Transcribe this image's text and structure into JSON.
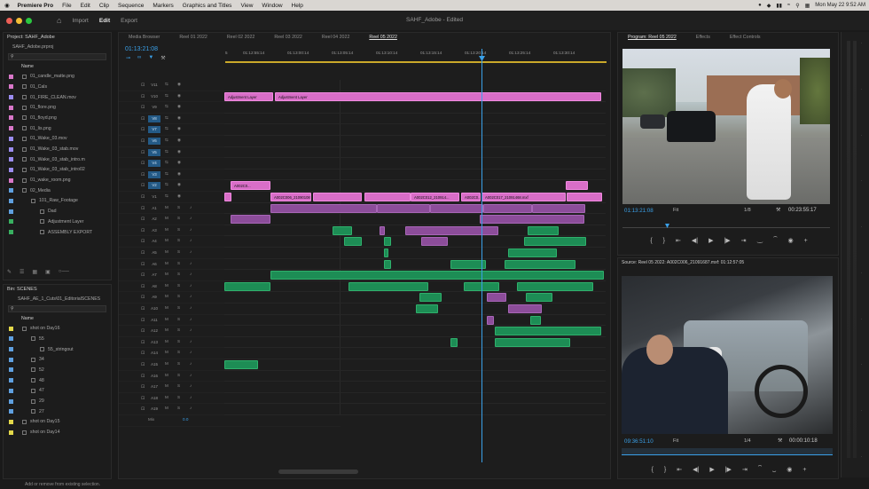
{
  "menubar": {
    "apple": "",
    "app": "Premiere Pro",
    "items": [
      "File",
      "Edit",
      "Clip",
      "Sequence",
      "Markers",
      "Graphics and Titles",
      "View",
      "Window",
      "Help"
    ],
    "clock": "Mon May 22  9:52 AM"
  },
  "topbar": {
    "workspaces": [
      "Import",
      "Edit",
      "Export"
    ],
    "active": "Edit",
    "document_title": "SAHF_Adobe - Edited"
  },
  "project_panel": {
    "title": "Project: SAHF_Adobe",
    "file": "SAHF_Adobe.prproj",
    "column": "Name",
    "items": [
      {
        "label": "01_candle_matte.png",
        "color": "#d977c9"
      },
      {
        "label": "01_Cals",
        "color": "#d977c9"
      },
      {
        "label": "01_FIRE_CLEAN.mov",
        "color": "#9b8cf0"
      },
      {
        "label": "01_flore.png",
        "color": "#d977c9"
      },
      {
        "label": "01_floyd.png",
        "color": "#d977c9"
      },
      {
        "label": "01_lis.png",
        "color": "#d977c9"
      },
      {
        "label": "01_Wake_03.mov",
        "color": "#9b8cf0"
      },
      {
        "label": "01_Wake_03_stab.mov",
        "color": "#9b8cf0"
      },
      {
        "label": "01_Wake_03_stab_intro.m",
        "color": "#9b8cf0"
      },
      {
        "label": "01_Wake_03_stab_intro02",
        "color": "#9b8cf0"
      },
      {
        "label": "01_wake_room.png",
        "color": "#d977c9"
      },
      {
        "label": "02_Media",
        "color": "#5fa0e0"
      },
      {
        "label": "101_Raw_Footage",
        "color": "#5fa0e0"
      },
      {
        "label": "Dad",
        "color": "#5fa0e0"
      },
      {
        "label": "Adjustment Layer",
        "color": "#38b060"
      },
      {
        "label": "ASSEMBLY EXPORT",
        "color": "#38b060"
      }
    ]
  },
  "bin_panel": {
    "title": "Bin: SCENES",
    "path": "SAHF_AE_1_Cuts\\01_EditorialSCENES",
    "column": "Name",
    "items": [
      {
        "label": "shot on Day16",
        "color": "#e3d84a"
      },
      {
        "label": "55",
        "color": "#5fa0e0"
      },
      {
        "label": "55_stringout",
        "color": "#5fa0e0"
      },
      {
        "label": "34",
        "color": "#5fa0e0"
      },
      {
        "label": "52",
        "color": "#5fa0e0"
      },
      {
        "label": "48",
        "color": "#5fa0e0"
      },
      {
        "label": "47",
        "color": "#5fa0e0"
      },
      {
        "label": "29",
        "color": "#5fa0e0"
      },
      {
        "label": "27",
        "color": "#5fa0e0"
      },
      {
        "label": "shot on Day15",
        "color": "#e3d84a"
      },
      {
        "label": "shot on Day14",
        "color": "#e3d84a"
      }
    ]
  },
  "timeline": {
    "tabs": [
      "Media Browser",
      "Reel 01 2022",
      "Reel 02 2022",
      "Reel 03 2022",
      "Reel 04 2022",
      "Reel 05 2022"
    ],
    "active_tab": "Reel 05 2022",
    "timecode": "01:13:21:08",
    "ruler": [
      "5",
      "01:12:55:14",
      "01:13:00:14",
      "01:13:05:14",
      "01:13:10:14",
      "01:13:15:14",
      "01:13:20:14",
      "01:13:25:14",
      "01:13:30:14"
    ],
    "video_tracks": [
      "V11",
      "V10",
      "V9",
      "V8",
      "V7",
      "V6",
      "V5",
      "V4",
      "V3",
      "V2",
      "V1"
    ],
    "audio_tracks": [
      "A1",
      "A2",
      "A3",
      "A4",
      "A5",
      "A6",
      "A7",
      "A8",
      "A9",
      "A10",
      "A11",
      "A12",
      "A13",
      "A14",
      "A15",
      "A16",
      "A17",
      "A18",
      "A19"
    ],
    "mix": "Mix",
    "mix_value": "0.0",
    "adjustment_labels": [
      "Adjustment Layer",
      "Adjustment Layer"
    ],
    "clip_labels": [
      "A002C0...",
      "A002C006_210901087.mxf",
      "A002C012_210914...",
      "A002C0...",
      "A002C017_21091468.mxf"
    ]
  },
  "program_monitor": {
    "tabs": [
      "Program: Reel 05 2022",
      "Effects",
      "Effect Controls"
    ],
    "timecode": "01:13:21:08",
    "fit": "Fit",
    "scale": "1/8",
    "duration": "00:23:55:17"
  },
  "source_monitor": {
    "title": "Source: Reel 05 2022: A002C006_21091687.mxf: 01:12:57:05",
    "timecode": "09:36:51:10",
    "fit": "Fit",
    "scale": "1/4",
    "duration": "00:00:10:18"
  },
  "status": {
    "text": "Add or remove from existing selection."
  },
  "colors": {
    "accent": "#3aa0e8",
    "adjustment": "#d96ec8",
    "audio": "#1d8d55",
    "video": "#8c4d9a"
  }
}
